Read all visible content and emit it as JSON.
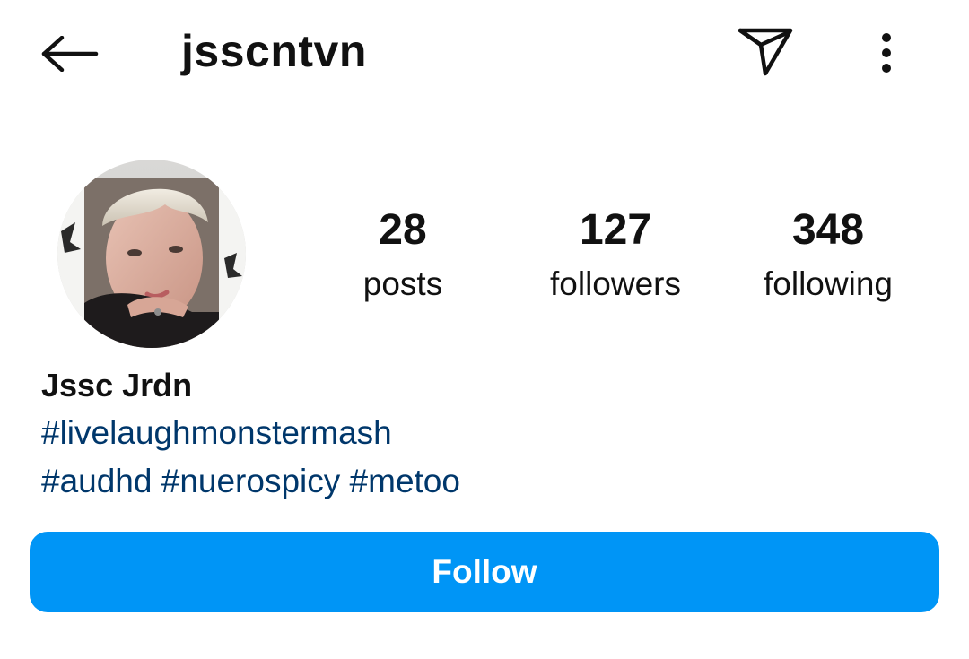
{
  "header": {
    "username": "jsscntvn",
    "back_icon": "arrow-left-icon",
    "send_icon": "paper-plane-icon",
    "more_icon": "vertical-dots-icon"
  },
  "profile": {
    "avatar": "profile-photo",
    "stats": [
      {
        "value": "28",
        "label": "posts"
      },
      {
        "value": "127",
        "label": "followers"
      },
      {
        "value": "348",
        "label": "following"
      }
    ],
    "display_name": "Jssc Jrdn",
    "bio_lines": [
      [
        "#livelaughmonstermash"
      ],
      [
        "#audhd",
        "#nuerospicy",
        "#metoo"
      ]
    ],
    "hashtag_color": "#00376b"
  },
  "actions": {
    "follow_label": "Follow",
    "follow_color": "#0095f6"
  }
}
